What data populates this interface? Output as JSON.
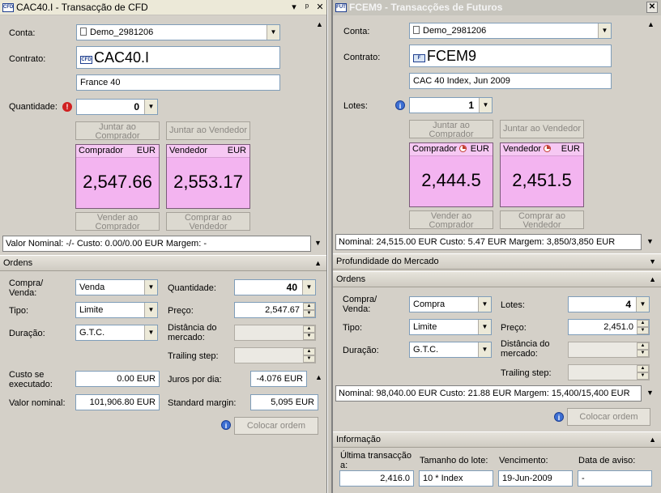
{
  "left": {
    "title": "CAC40.I - Transacção de CFD",
    "title_icon": "CFD",
    "conta_label": "Conta:",
    "conta_value": "Demo_2981206",
    "contrato_label": "Contrato:",
    "contrato_icon": "CFD",
    "contrato_value": "CAC40.I",
    "description": "France 40",
    "quantidade_label": "Quantidade:",
    "quantidade_value": "0",
    "join_buyer": "Juntar ao Comprador",
    "join_seller": "Juntar ao Vendedor",
    "buyer_tile": {
      "label": "Comprador",
      "currency": "EUR",
      "price": "2,547.66"
    },
    "seller_tile": {
      "label": "Vendedor",
      "currency": "EUR",
      "price": "2,553.17"
    },
    "sell_to_buyer": "Vender ao Comprador",
    "buy_from_seller": "Comprar ao Vendedor",
    "summary": "Valor Nominal: -/-   Custo: 0.00/0.00 EUR   Margem: -",
    "orders_header": "Ordens",
    "compra_venda_label": "Compra/ Venda:",
    "compra_venda_value": "Venda",
    "tipo_label": "Tipo:",
    "tipo_value": "Limite",
    "duracao_label": "Duração:",
    "duracao_value": "G.T.C.",
    "quantidade2_label": "Quantidade:",
    "quantidade2_value": "40",
    "preco_label": "Preço:",
    "preco_value": "2,547.67",
    "distancia_label": "Distância do mercado:",
    "trailing_label": "Trailing step:",
    "custo_label": "Custo se executado:",
    "custo_value": "0.00 EUR",
    "valor_label": "Valor nominal:",
    "valor_value": "101,906.80 EUR",
    "juros_label": "Juros por dia:",
    "juros_value": "-4.076 EUR",
    "margin_label": "Standard margin:",
    "margin_value": "5,095 EUR",
    "place_order": "Colocar ordem"
  },
  "right": {
    "title": "FCEM9 - Transacções de Futuros",
    "title_icon": "FUT",
    "conta_label": "Conta:",
    "conta_value": "Demo_2981206",
    "contrato_label": "Contrato:",
    "contrato_value": "FCEM9",
    "description": "CAC 40 Index, Jun 2009",
    "lotes_label": "Lotes:",
    "lotes_value": "1",
    "join_buyer": "Juntar ao Comprador",
    "join_seller": "Juntar ao Vendedor",
    "buyer_tile": {
      "label": "Comprador",
      "currency": "EUR",
      "price": "2,444.5"
    },
    "seller_tile": {
      "label": "Vendedor",
      "currency": "EUR",
      "price": "2,451.5"
    },
    "sell_to_buyer": "Vender ao Comprador",
    "buy_from_seller": "Comprar ao Vendedor",
    "summary": "Nominal: 24,515.00 EUR   Custo: 5.47 EUR   Margem: 3,850/3,850 EUR",
    "depth_header": "Profundidade do Mercado",
    "orders_header": "Ordens",
    "compra_venda_label": "Compra/ Venda:",
    "compra_venda_value": "Compra",
    "tipo_label": "Tipo:",
    "tipo_value": "Limite",
    "duracao_label": "Duração:",
    "duracao_value": "G.T.C.",
    "lotes2_label": "Lotes:",
    "lotes2_value": "4",
    "preco_label": "Preço:",
    "preco_value": "2,451.0",
    "distancia_label": "Distância do mercado:",
    "trailing_label": "Trailing step:",
    "orders_summary": "Nominal: 98,040.00 EUR   Custo: 21.88 EUR   Margem: 15,400/15,400 EUR",
    "place_order": "Colocar ordem",
    "info_header": "Informação",
    "info": {
      "last_trade_label": "Última transacção a:",
      "last_trade_value": "2,416.0",
      "lot_size_label": "Tamanho do lote:",
      "lot_size_value": "10 * Index",
      "expiry_label": "Vencimento:",
      "expiry_value": "19-Jun-2009",
      "notice_label": "Data de aviso:",
      "notice_value": "-"
    }
  }
}
